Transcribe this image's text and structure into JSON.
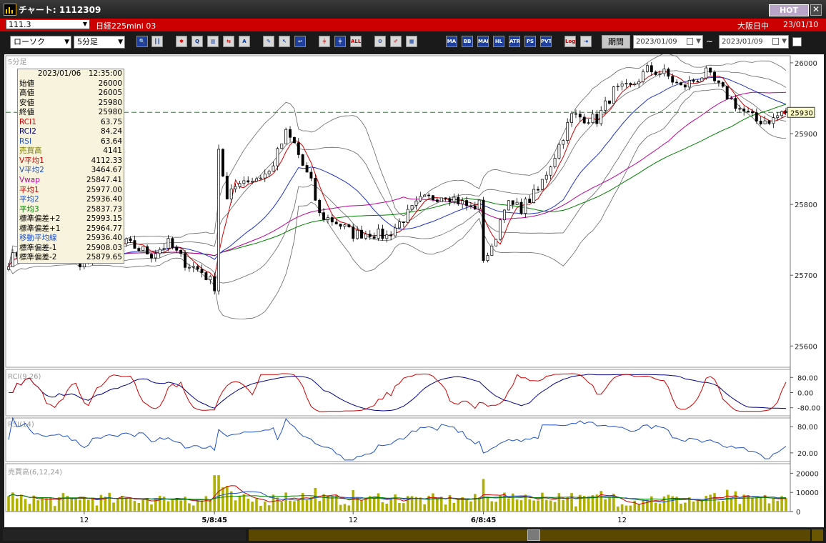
{
  "window": {
    "title": "チャート: 1112309",
    "hot_label": "HOT",
    "close_label": "✕"
  },
  "symbol_bar": {
    "code": "111.3",
    "instrument": "日経225mini 03",
    "session": "大阪日中",
    "date": "23/01/10"
  },
  "toolbar": {
    "chart_type": "ローソク",
    "interval": "5分足",
    "buttons": [
      {
        "name": "zoom-icon",
        "label": "🔍",
        "style": "blue"
      },
      {
        "name": "bars-icon",
        "label": "┃┃",
        "style": ""
      },
      {
        "name": "stamp-icon",
        "label": "✱",
        "style": "red"
      },
      {
        "name": "lens-icon",
        "label": "Q",
        "style": ""
      },
      {
        "name": "bar-chart-icon",
        "label": "▥",
        "style": ""
      },
      {
        "name": "arrows-icon",
        "label": "⇆",
        "style": "red"
      },
      {
        "name": "text-icon",
        "label": "A",
        "style": ""
      },
      {
        "name": "pen-icon",
        "label": "✎",
        "style": ""
      },
      {
        "name": "cursor-icon",
        "label": "↖",
        "style": ""
      },
      {
        "name": "return-icon",
        "label": "↩",
        "style": "blue"
      },
      {
        "name": "candle-up-icon",
        "label": "╪",
        "style": "red"
      },
      {
        "name": "candle-down-icon",
        "label": "╪",
        "style": "blue"
      },
      {
        "name": "all-icon",
        "label": "ALL",
        "style": "red"
      },
      {
        "name": "gear-icon",
        "label": "⚙",
        "style": ""
      },
      {
        "name": "brush-icon",
        "label": "✐",
        "style": "red"
      },
      {
        "name": "palette-icon",
        "label": "▦",
        "style": ""
      },
      {
        "name": "ma-icon",
        "label": "MA",
        "style": "blue"
      },
      {
        "name": "bb-icon",
        "label": "BB",
        "style": "blue"
      },
      {
        "name": "mae-icon",
        "label": "MAE",
        "style": "blue"
      },
      {
        "name": "hl-icon",
        "label": "HL",
        "style": "blue"
      },
      {
        "name": "atr-icon",
        "label": "ATR",
        "style": "blue"
      },
      {
        "name": "ps-icon",
        "label": "PS",
        "style": "blue"
      },
      {
        "name": "pvt-icon",
        "label": "PVT",
        "style": "blue"
      },
      {
        "name": "log-icon",
        "label": "Log",
        "style": "red"
      },
      {
        "name": "export-icon",
        "label": "⇥",
        "style": ""
      }
    ],
    "period_label": "期間",
    "date_from": "2023/01/09",
    "date_to": "2023/01/09",
    "tilde": "~"
  },
  "chart_data": {
    "type": "candlestick",
    "interval_label": "5分足",
    "price_axis": {
      "ticks": [
        25600,
        25700,
        25800,
        25900,
        26000
      ],
      "ylim": [
        25570,
        26010
      ]
    },
    "current_price": 25930,
    "current_price_label": "25930",
    "x_labels": [
      {
        "label": "12",
        "idx": 18
      },
      {
        "label": "5/8:45",
        "idx": 49
      },
      {
        "label": "12",
        "idx": 82
      },
      {
        "label": "6/8:45",
        "idx": 113
      },
      {
        "label": "12",
        "idx": 146
      }
    ],
    "info": {
      "datetime": "2023/01/06　12:35:00",
      "rows": [
        {
          "k": "始値",
          "v": "26000",
          "color": "#000"
        },
        {
          "k": "高値",
          "v": "26005",
          "color": "#000"
        },
        {
          "k": "安値",
          "v": "25980",
          "color": "#000"
        },
        {
          "k": "終値",
          "v": "25980",
          "color": "#000"
        },
        {
          "k": "RCI1",
          "v": "63.75",
          "color": "#d00000"
        },
        {
          "k": "RCI2",
          "v": "84.24",
          "color": "#00008b"
        },
        {
          "k": "RSI",
          "v": "63.64",
          "color": "#1e50c8"
        },
        {
          "k": "売買高",
          "v": "4141",
          "color": "#808000"
        },
        {
          "k": "V平均1",
          "v": "4112.33",
          "color": "#d00000"
        },
        {
          "k": "V平均2",
          "v": "3464.67",
          "color": "#1e50c8"
        },
        {
          "k": "Vwap",
          "v": "25847.41",
          "color": "#c0009a"
        },
        {
          "k": "平均1",
          "v": "25977.00",
          "color": "#d00000"
        },
        {
          "k": "平均2",
          "v": "25936.40",
          "color": "#1e50c8"
        },
        {
          "k": "平均3",
          "v": "25837.73",
          "color": "#008000"
        },
        {
          "k": "標準偏差+2",
          "v": "25993.15",
          "color": "#000"
        },
        {
          "k": "標準偏差+1",
          "v": "25964.77",
          "color": "#000"
        },
        {
          "k": "移動平均線",
          "v": "25936.40",
          "color": "#1e50c8"
        },
        {
          "k": "標準偏差-1",
          "v": "25908.03",
          "color": "#000"
        },
        {
          "k": "標準偏差-2",
          "v": "25879.65",
          "color": "#000"
        }
      ]
    },
    "anchors": [
      [
        0,
        25720
      ],
      [
        4,
        25740
      ],
      [
        8,
        25720
      ],
      [
        14,
        25730
      ],
      [
        18,
        25715
      ],
      [
        22,
        25735
      ],
      [
        28,
        25745
      ],
      [
        34,
        25730
      ],
      [
        38,
        25745
      ],
      [
        42,
        25718
      ],
      [
        46,
        25705
      ],
      [
        49,
        25685
      ],
      [
        50,
        25880
      ],
      [
        52,
        25805
      ],
      [
        55,
        25835
      ],
      [
        58,
        25835
      ],
      [
        62,
        25845
      ],
      [
        66,
        25900
      ],
      [
        68,
        25885
      ],
      [
        70,
        25855
      ],
      [
        72,
        25830
      ],
      [
        74,
        25785
      ],
      [
        78,
        25775
      ],
      [
        82,
        25758
      ],
      [
        86,
        25760
      ],
      [
        90,
        25755
      ],
      [
        94,
        25780
      ],
      [
        98,
        25805
      ],
      [
        104,
        25815
      ],
      [
        110,
        25795
      ],
      [
        112,
        25800
      ],
      [
        113,
        25725
      ],
      [
        115,
        25735
      ],
      [
        118,
        25800
      ],
      [
        122,
        25795
      ],
      [
        126,
        25820
      ],
      [
        130,
        25870
      ],
      [
        134,
        25925
      ],
      [
        140,
        25920
      ],
      [
        144,
        25960
      ],
      [
        148,
        25965
      ],
      [
        152,
        25990
      ],
      [
        156,
        25985
      ],
      [
        160,
        25965
      ],
      [
        166,
        25985
      ],
      [
        170,
        25960
      ],
      [
        174,
        25935
      ],
      [
        178,
        25918
      ],
      [
        182,
        25920
      ],
      [
        184,
        25930
      ]
    ],
    "rci_axis": {
      "ticks": [
        80,
        0,
        -80
      ],
      "tick_labels": [
        "80.00",
        "0.00",
        "-80.00"
      ]
    },
    "rsi_axis": {
      "ticks": [
        80,
        20
      ],
      "tick_labels": [
        "80.00",
        "20.00"
      ]
    },
    "vol_axis": {
      "ticks": [
        20000,
        10000,
        0
      ],
      "tick_labels": [
        "20000",
        "10000",
        "0"
      ]
    },
    "panels": {
      "price": {
        "label": "5分足"
      },
      "rci": {
        "label": "RCI(9,26)"
      },
      "rsi": {
        "label": "RSI(14)"
      },
      "volume": {
        "label": "売買高(6,12,24)"
      }
    }
  }
}
